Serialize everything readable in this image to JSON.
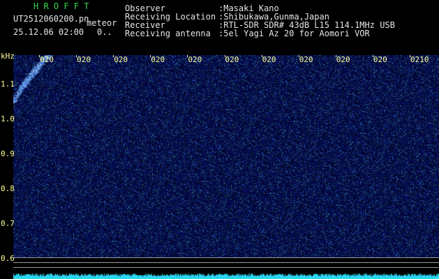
{
  "header": {
    "mode": "H R O F F T",
    "filename": "UT2512060200.pn",
    "label": "meteor",
    "datetime": "25.12.06 02:00",
    "status": "0..",
    "fields": [
      {
        "key": "Observer",
        "value": ":Masaki Kano"
      },
      {
        "key": "Receiving Location",
        "value": ":Shibukawa,Gunma,Japan"
      },
      {
        "key": "Receiver",
        "value": ":RTL-SDR SDR# 43dB L15 114.1MHz USB"
      },
      {
        "key": "Receiving antenna",
        "value": ":5el Yagi Az 20 for Aomori VOR"
      }
    ]
  },
  "chart_data": {
    "type": "heatmap",
    "ylabel": "kHz",
    "y_ticks": [
      "1.1",
      "1.0",
      "0.9",
      "0.8",
      "0.7",
      "0.6"
    ],
    "ylim": [
      0.6,
      1.2
    ],
    "time_labels": [
      "020",
      "020",
      "020",
      "020",
      "020",
      "020",
      "020",
      "020",
      "020",
      "020",
      "0210"
    ],
    "x_range_minutes": [
      0,
      10
    ],
    "echo_trace": {
      "start": {
        "t_min": 0.0,
        "khz": 1.05
      },
      "end": {
        "t_min": 0.95,
        "khz": 1.2
      }
    }
  },
  "colors": {
    "background": "#000000",
    "title": "#36d84a",
    "header_text": "#e6e6e6",
    "axis_text": "#ffff9a",
    "noise": "#1a2a9a",
    "echo": "#7ab8ff",
    "level_bar": "#2ad6f0",
    "separator": "#9a9a9a"
  }
}
